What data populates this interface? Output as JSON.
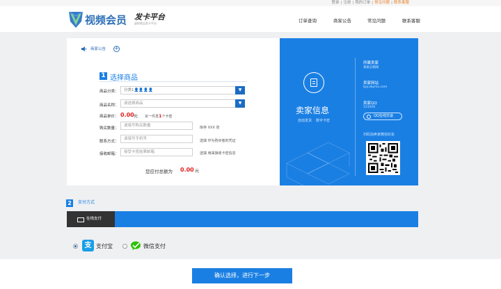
{
  "topbar": {
    "login": "登录",
    "sep1": "|",
    "register": "注册",
    "sep2": "|",
    "my_orders": "我的订单",
    "sep3": "|",
    "faq": "常见问题",
    "sep4": "|",
    "contact": "联系客服"
  },
  "brand": {
    "name": "视频会员",
    "subtitle": "发卡平台",
    "tagline": "虚拟商品发卡平台"
  },
  "nav": {
    "items": [
      "订单查询",
      "商家公告",
      "常见问题",
      "联系客服"
    ]
  },
  "notice": {
    "label": "商家公告"
  },
  "step1": {
    "number": "1",
    "title": "选择商品",
    "category_label": "商品分类：",
    "category_value": "分类1👤👤👤👤",
    "product_label": "商品名称：",
    "product_placeholder": "请选择商品",
    "price_label": "商品单价：",
    "price_value": "0.00",
    "price_unit": "元",
    "promo_prefix": "买一件发",
    "promo_count": "1",
    "promo_suffix": "个卡密",
    "quantity_label": "购买数量：",
    "quantity_placeholder": "请填写购买数量",
    "stock_hint": "库存 XXX 张",
    "contact_label": "联系方式：",
    "contact_placeholder": "请填写手机号",
    "contact_hint": "选填 作为购买者的凭证",
    "email_label": "接收邮箱：",
    "email_placeholder": "接受卡密结果邮箱",
    "email_hint": "选填 用来接收卡密信息",
    "total_label": "您应付总额为",
    "total_value": "0.00",
    "total_unit": "元"
  },
  "seller": {
    "title": "卖家信息",
    "badge1": "自动发货",
    "badge2": "数字卡密",
    "owner_label": "所属卖家",
    "owner_value": "系统分销商",
    "site_label": "卖家网站",
    "site_value": "tpy.akymu.com",
    "qq_label": "卖家QQ",
    "qq_value": "123456",
    "qq_button": "QQ在线交谈",
    "scan_caption": "扫码加卖家微信好友"
  },
  "step2": {
    "number": "2",
    "title": "支付方式",
    "tab_online": "在线支付"
  },
  "payment": {
    "alipay": "支付宝",
    "wechat": "微信支付",
    "selected": "alipay"
  },
  "confirm_button": "确认选择，进行下一步",
  "colors": {
    "accent": "#1a7fe3",
    "price": "#e02020",
    "warning": "#e8812b"
  }
}
